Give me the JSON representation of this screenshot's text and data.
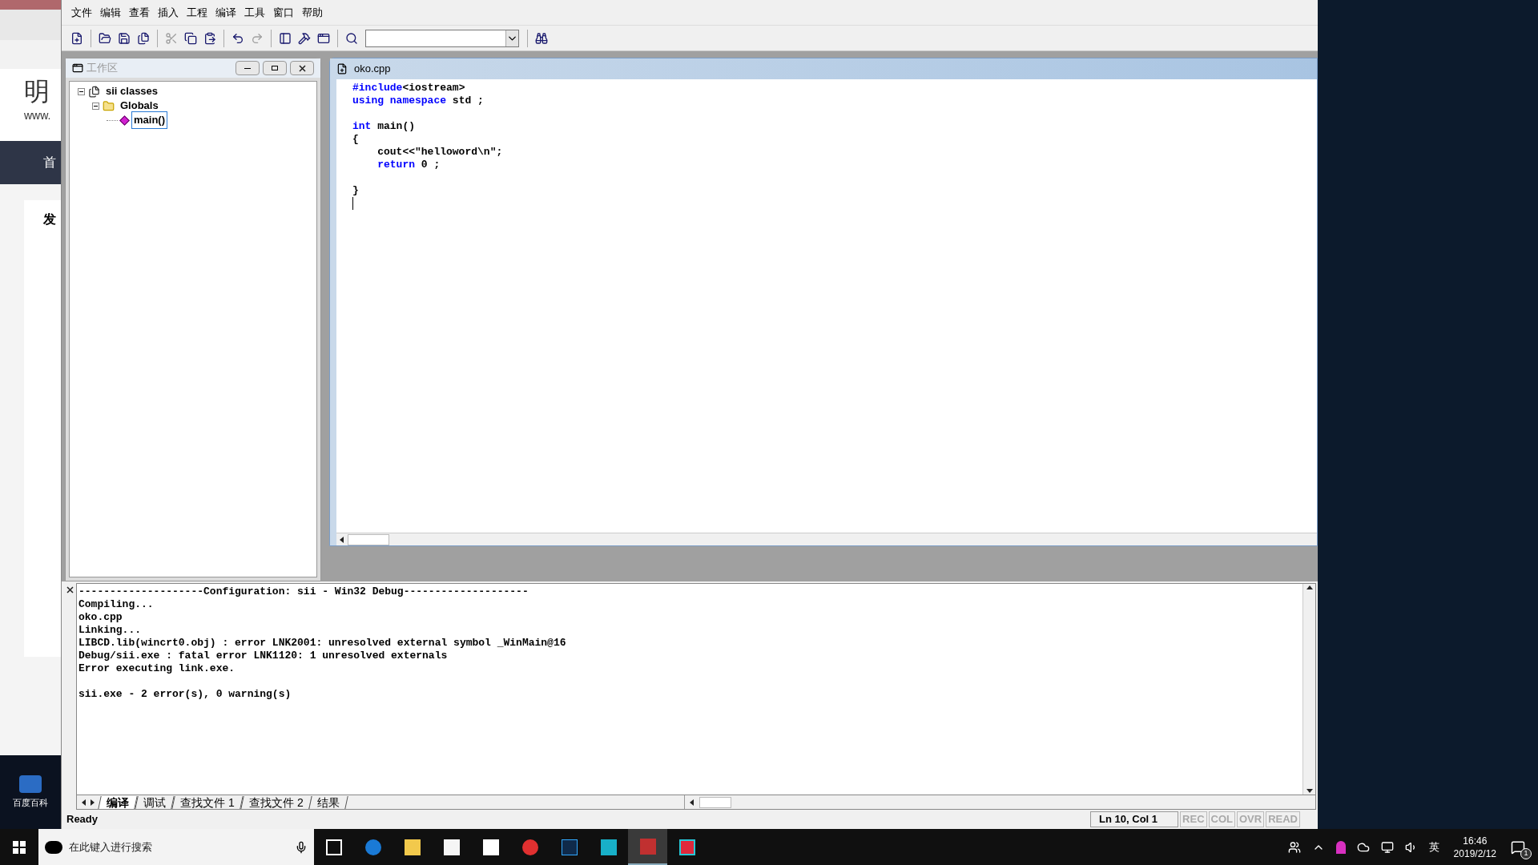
{
  "browser_fragment": {
    "logo_char": "明",
    "url_fragment": "www.",
    "nav_char": "首",
    "card_char": "发",
    "desktop_icon_label": "百度百科"
  },
  "menu": [
    "文件",
    "编辑",
    "查看",
    "插入",
    "工程",
    "编译",
    "工具",
    "窗口",
    "帮助"
  ],
  "toolbar": [
    {
      "kind": "new",
      "disabled": false
    },
    {
      "kind": "open",
      "disabled": false
    },
    {
      "kind": "save",
      "disabled": false
    },
    {
      "kind": "saveall",
      "disabled": false
    },
    {
      "kind": "cut",
      "disabled": true
    },
    {
      "kind": "copy",
      "disabled": false
    },
    {
      "kind": "paste",
      "disabled": false
    },
    {
      "kind": "undo",
      "disabled": false
    },
    {
      "kind": "redo",
      "disabled": true
    },
    {
      "kind": "workspace",
      "disabled": false
    },
    {
      "kind": "output",
      "disabled": false
    },
    {
      "kind": "windows",
      "disabled": false
    },
    {
      "kind": "find",
      "disabled": false
    },
    {
      "kind": "combo",
      "disabled": false
    },
    {
      "kind": "findfiles",
      "disabled": false
    }
  ],
  "workspace": {
    "title": "工作区",
    "tree": [
      {
        "label": "sii classes",
        "kind": "classes",
        "expanded": true,
        "selected": false,
        "children": [
          {
            "label": "Globals",
            "kind": "folder",
            "expanded": true,
            "selected": false,
            "children": [
              {
                "label": "main()",
                "kind": "function",
                "selected": true
              }
            ]
          }
        ]
      }
    ]
  },
  "editor": {
    "title": "oko.cpp",
    "lines": [
      {
        "kind": "code",
        "tokens": [
          {
            "text": "#include",
            "kind": "keyword"
          },
          {
            "text": "<iostream>",
            "kind": "plain"
          }
        ]
      },
      {
        "kind": "code",
        "tokens": [
          {
            "text": "using",
            "kind": "keyword"
          },
          {
            "text": " namespace",
            "kind": "keyword"
          },
          {
            "text": " std ;",
            "kind": "plain"
          }
        ]
      },
      {
        "kind": "blank"
      },
      {
        "kind": "code",
        "tokens": [
          {
            "text": "int",
            "kind": "keyword"
          },
          {
            "text": " main()",
            "kind": "plain"
          }
        ]
      },
      {
        "kind": "code",
        "tokens": [
          {
            "text": "{",
            "kind": "plain"
          }
        ]
      },
      {
        "kind": "code",
        "tokens": [
          {
            "text": "    cout<<\"helloword\\n\";",
            "kind": "plain"
          }
        ]
      },
      {
        "kind": "code",
        "tokens": [
          {
            "text": "    return",
            "kind": "keyword"
          },
          {
            "text": " 0 ;",
            "kind": "plain"
          }
        ]
      },
      {
        "kind": "blank"
      },
      {
        "kind": "code",
        "tokens": [
          {
            "text": "}",
            "kind": "plain"
          }
        ]
      },
      {
        "kind": "cursor"
      }
    ]
  },
  "output": {
    "lines": [
      {
        "kind": "text",
        "text": "--------------------Configuration: sii - Win32 Debug--------------------"
      },
      {
        "kind": "text",
        "text": "Compiling..."
      },
      {
        "kind": "text",
        "text": "oko.cpp"
      },
      {
        "kind": "text",
        "text": "Linking..."
      },
      {
        "kind": "text",
        "text": "LIBCD.lib(wincrt0.obj) : error LNK2001: unresolved external symbol _WinMain@16"
      },
      {
        "kind": "text",
        "text": "Debug/sii.exe : fatal error LNK1120: 1 unresolved externals"
      },
      {
        "kind": "text",
        "text": "Error executing link.exe."
      },
      {
        "kind": "blank"
      },
      {
        "kind": "text",
        "text": "sii.exe - 2 error(s), 0 warning(s)"
      }
    ],
    "tabs": [
      {
        "label": "编译",
        "selected": true
      },
      {
        "label": "调试",
        "selected": false
      },
      {
        "label": "查找文件 1",
        "selected": false
      },
      {
        "label": "查找文件 2",
        "selected": false
      },
      {
        "label": "结果",
        "selected": false
      }
    ]
  },
  "status_bar": {
    "message": "Ready",
    "position": "Ln 10, Col 1",
    "indicators": [
      {
        "label": "REC",
        "on": false
      },
      {
        "label": "COL",
        "on": false
      },
      {
        "label": "OVR",
        "on": false
      },
      {
        "label": "READ",
        "on": false
      }
    ]
  },
  "taskbar": {
    "search_placeholder": "在此键入进行搜索",
    "apps": [
      {
        "kind": "taskview",
        "active": false
      },
      {
        "kind": "edge",
        "active": false
      },
      {
        "kind": "explorer",
        "active": false
      },
      {
        "kind": "store",
        "active": false
      },
      {
        "kind": "mail",
        "active": false
      },
      {
        "kind": "music",
        "active": false
      },
      {
        "kind": "ps",
        "active": false
      },
      {
        "kind": "qq",
        "active": false
      },
      {
        "kind": "vc",
        "active": true
      },
      {
        "kind": "red",
        "active": false
      }
    ],
    "ime": "英",
    "time": "16:46",
    "date": "2019/2/12",
    "notifications": "1"
  }
}
